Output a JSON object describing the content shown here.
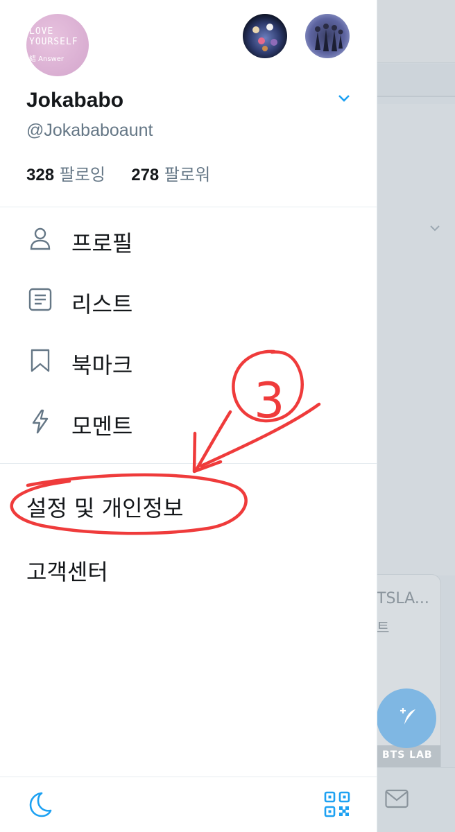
{
  "profile": {
    "name": "Jokababo",
    "handle": "@Jokababoaunt",
    "avatar_text_line1": "LOVE",
    "avatar_text_line2": "YOURSELF",
    "avatar_text_line3": "結 Answer",
    "following_count": "328",
    "following_label": "팔로잉",
    "followers_count": "278",
    "followers_label": "팔로워"
  },
  "menu": {
    "items": [
      {
        "label": "프로필",
        "icon": "person-icon"
      },
      {
        "label": "리스트",
        "icon": "list-icon"
      },
      {
        "label": "북마크",
        "icon": "bookmark-icon"
      },
      {
        "label": "모멘트",
        "icon": "lightning-icon"
      }
    ],
    "settings_label": "설정 및 개인정보",
    "help_label": "고객센터"
  },
  "annotation": {
    "number": "3",
    "color": "#ef3b3b"
  },
  "background": {
    "card_title": "TSLA...",
    "card_subtitle": "트",
    "card_image_text": "BTS LAB"
  },
  "footer": {
    "left_icon": "moon-icon",
    "right_icon": "qr-code-icon"
  },
  "colors": {
    "accent": "#1da1f2",
    "text_primary": "#14171a",
    "text_secondary": "#657786"
  }
}
